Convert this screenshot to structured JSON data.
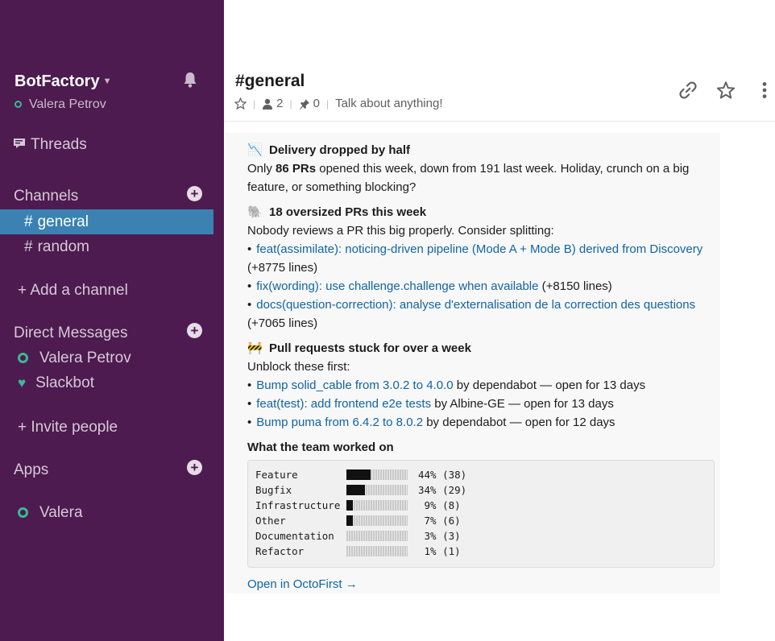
{
  "sidebar": {
    "team_name": "BotFactory",
    "user_name": "Valera Petrov",
    "threads_label": "Threads",
    "channels_heading": "Channels",
    "channels": [
      {
        "name": "general",
        "active": true
      },
      {
        "name": "random",
        "active": false
      }
    ],
    "add_channel_label": "+ Add a channel",
    "dm_heading": "Direct Messages",
    "direct_messages": [
      {
        "name": "Valera Petrov",
        "status": "online"
      },
      {
        "name": "Slackbot",
        "status": "heart"
      }
    ],
    "invite_label": "+ Invite people",
    "apps_heading": "Apps",
    "apps": [
      {
        "name": "Valera",
        "status": "online"
      }
    ],
    "hash": "#",
    "add_symbol": "+"
  },
  "header": {
    "channel_name": "#general",
    "members_count": "2",
    "pins_count": "0",
    "topic": "Talk about anything!",
    "separator": "|"
  },
  "message": {
    "sections": [
      {
        "emoji": "📉",
        "title": "Delivery dropped by half",
        "body_prefix": "Only ",
        "body_bold": "86 PRs",
        "body_suffix": " opened this week, down from 191 last week. Holiday, crunch on a big feature, or something blocking?"
      },
      {
        "emoji": "🐘",
        "title": "18 oversized PRs this week",
        "intro": "Nobody reviews a PR this big properly. Consider splitting:",
        "items": [
          {
            "link": "feat(assimilate): noticing-driven pipeline (Mode A + Mode B) derived from Discovery",
            "suffix": " (+8775 lines)"
          },
          {
            "link": "fix(wording): use challenge.challenge when available",
            "suffix": " (+8150 lines)"
          },
          {
            "link": "docs(question-correction): analyse d'externalisation de la correction des questions",
            "suffix": " (+7065 lines)"
          }
        ]
      },
      {
        "emoji": "🚧",
        "title": "Pull requests stuck for over a week",
        "intro": "Unblock these first:",
        "items": [
          {
            "link": "Bump solid_cable from 3.0.2 to 4.0.0",
            "suffix": " by dependabot — open for 13 days"
          },
          {
            "link": "feat(test): add frontend e2e tests",
            "suffix": " by Albine-GE — open for 13 days"
          },
          {
            "link": "Bump puma from 6.4.2 to 8.0.2",
            "suffix": " by dependabot — open for 12 days"
          }
        ]
      }
    ],
    "work_heading": "What the team worked on",
    "work_stats": [
      {
        "label": "Feature",
        "fraction": 0.44,
        "value": "44% (38)"
      },
      {
        "label": "Bugfix",
        "fraction": 0.34,
        "value": "34% (29)"
      },
      {
        "label": "Infrastructure",
        "fraction": 0.09,
        "value": " 9% (8)"
      },
      {
        "label": "Other",
        "fraction": 0.07,
        "value": " 7% (6)"
      },
      {
        "label": "Documentation",
        "fraction": 0.03,
        "value": " 3% (3)"
      },
      {
        "label": "Refactor",
        "fraction": 0.01,
        "value": " 1% (1)"
      }
    ],
    "bullet": "•",
    "open_link": "Open in OctoFirst →"
  },
  "colors": {
    "sidebar_bg": "#4d1b4f",
    "active_channel": "#3b82b3",
    "presence": "#3eb890",
    "link": "#1264a3"
  }
}
